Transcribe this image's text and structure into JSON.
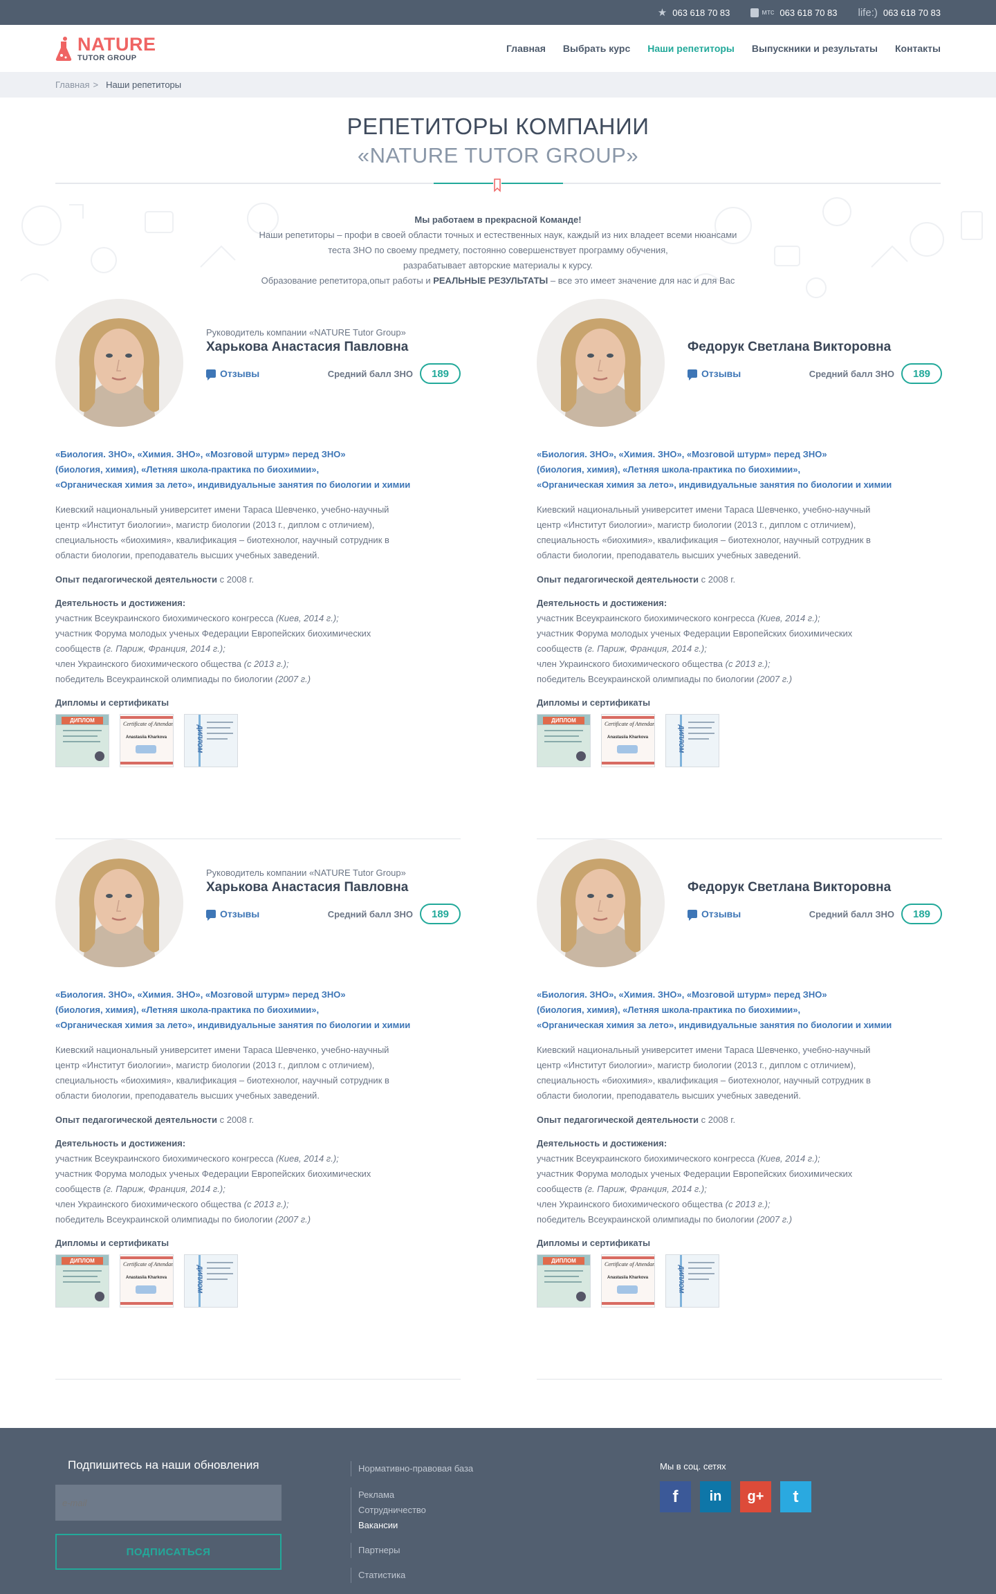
{
  "topbar": {
    "phones": [
      {
        "operator_icon": "star-icon",
        "operator_label": "",
        "number": "063 618 70 83"
      },
      {
        "operator_icon": "mts-icon",
        "operator_label": "мтс",
        "number": "063 618 70 83"
      },
      {
        "operator_icon": "life-icon",
        "operator_label": "life:)",
        "number": "063 618 70 83"
      }
    ]
  },
  "header": {
    "logo_main": "NATURE",
    "logo_sub": "TUTOR GROUP",
    "nav": [
      {
        "label": "Главная",
        "active": false
      },
      {
        "label": "Выбрать курс",
        "active": false
      },
      {
        "label": "Наши репетиторы",
        "active": true
      },
      {
        "label": "Выпускники и результаты",
        "active": false
      },
      {
        "label": "Контакты",
        "active": false
      }
    ]
  },
  "breadcrumb": {
    "home": "Главная",
    "separator": ">",
    "current": "Наши репетиторы"
  },
  "page": {
    "title_line1": "РЕПЕТИТОРЫ КОМПАНИИ",
    "title_line2": "«NATURE TUTOR GROUP»",
    "intro_bold": "Мы работаем в прекрасной Команде!",
    "intro_line1": "Наши репетиторы – профи в своей области точных и естественных наук, каждый из них владеет всеми нюансами",
    "intro_line2": "теста ЗНО по своему предмету,  постоянно совершенствует программу обучения,",
    "intro_line3": "разрабатывает авторские материалы к курсу.",
    "intro_line4_pre": "Образование репетитора,опыт работы и ",
    "intro_line4_bold": "РЕАЛЬНЫЕ РЕЗУЛЬТАТЫ",
    "intro_line4_post": " – все это имеет значение для нас и для Вас"
  },
  "tutors": [
    {
      "role": "Руководитель компании «NATURE Tutor Group»",
      "name": "Харькова Анастасия Павловна",
      "reviews_label": "Отзывы",
      "score_label": "Средний балл ЗНО",
      "score": "189",
      "courses_l1": "«Биология. ЗНО», «Химия. ЗНО», «Мозговой штурм» перед ЗНО»",
      "courses_l2": "(биология, химия), «Летняя школа-практика по биохимии»,",
      "courses_l3": "«Органическая химия за лето», индивидуальные занятия по биологии и химии",
      "edu_l1": "Киевский национальный университет имени Тараса Шевченко, учебно-научный",
      "edu_l2": "центр «Институт биологии», магистр биологии (2013 г., диплом с отличием),",
      "edu_l3": "специальность «биохимия», квалификация – биотехнолог, научный сотрудник в",
      "edu_l4": "области биологии, преподаватель высших учебных заведений.",
      "exp_label": "Опыт педагогической деятельности",
      "exp_value": " с 2008 г.",
      "ach_title": "Деятельность и достижения:",
      "ach_1": "участник Всеукраинского биохимического конгресса ",
      "ach_1i": "(Киев, 2014 г.);",
      "ach_2": "участник Форума молодых ученых Федерации Европейских биохимических",
      "ach_3": "сообществ ",
      "ach_3i": "(г. Париж, Франция, 2014 г.);",
      "ach_4": "член Украинского биохимического общества ",
      "ach_4i": "(с 2013 г.);",
      "ach_5": "победитель Всеукраинской олимпиады по биологии ",
      "ach_5i": "(2007 г.)",
      "diplomas_label": "Дипломы и сертификаты",
      "cert_1": "ДИПЛОМ",
      "cert_2": "Certificate of Attendan",
      "cert_2b": "Anastasiia Kharkova",
      "cert_3": "ДИПЛОМ"
    },
    {
      "role": "",
      "name": "Федорук Светлана Викторовна",
      "reviews_label": "Отзывы",
      "score_label": "Средний балл ЗНО",
      "score": "189",
      "courses_l1": "«Биология. ЗНО», «Химия. ЗНО», «Мозговой штурм» перед ЗНО»",
      "courses_l2": "(биология, химия), «Летняя школа-практика по биохимии»,",
      "courses_l3": "«Органическая химия за лето», индивидуальные занятия по биологии и химии",
      "edu_l1": "Киевский национальный университет имени Тараса Шевченко, учебно-научный",
      "edu_l2": "центр «Институт биологии», магистр биологии (2013 г., диплом с отличием),",
      "edu_l3": "специальность «биохимия», квалификация – биотехнолог, научный сотрудник в",
      "edu_l4": "области биологии, преподаватель высших учебных заведений.",
      "exp_label": "Опыт педагогической деятельности",
      "exp_value": " с 2008 г.",
      "ach_title": "Деятельность и достижения:",
      "ach_1": "участник Всеукраинского биохимического конгресса ",
      "ach_1i": "(Киев, 2014 г.);",
      "ach_2": "участник Форума молодых ученых Федерации Европейских биохимических",
      "ach_3": "сообществ ",
      "ach_3i": "(г. Париж, Франция, 2014 г.);",
      "ach_4": "член Украинского биохимического общества ",
      "ach_4i": "(с 2013 г.);",
      "ach_5": "победитель Всеукраинской олимпиады по биологии ",
      "ach_5i": "(2007 г.)",
      "diplomas_label": "Дипломы и сертификаты",
      "cert_1": "ДИПЛОМ",
      "cert_2": "Certificate of Attendan",
      "cert_2b": "Anastasiia Kharkova",
      "cert_3": "ДИПЛОМ"
    },
    {
      "role": "Руководитель компании «NATURE Tutor Group»",
      "name": "Харькова Анастасия Павловна",
      "reviews_label": "Отзывы",
      "score_label": "Средний балл ЗНО",
      "score": "189",
      "courses_l1": "«Биология. ЗНО», «Химия. ЗНО», «Мозговой штурм» перед ЗНО»",
      "courses_l2": "(биология, химия), «Летняя школа-практика по биохимии»,",
      "courses_l3": "«Органическая химия за лето», индивидуальные занятия по биологии и химии",
      "edu_l1": "Киевский национальный университет имени Тараса Шевченко, учебно-научный",
      "edu_l2": "центр «Институт биологии», магистр биологии (2013 г., диплом с отличием),",
      "edu_l3": "специальность «биохимия», квалификация – биотехнолог, научный сотрудник в",
      "edu_l4": "области биологии, преподаватель высших учебных заведений.",
      "exp_label": "Опыт педагогической деятельности",
      "exp_value": " с 2008 г.",
      "ach_title": "Деятельность и достижения:",
      "ach_1": "участник Всеукраинского биохимического конгресса ",
      "ach_1i": "(Киев, 2014 г.);",
      "ach_2": "участник Форума молодых ученых Федерации Европейских биохимических",
      "ach_3": "сообществ ",
      "ach_3i": "(г. Париж, Франция, 2014 г.);",
      "ach_4": "член Украинского биохимического общества ",
      "ach_4i": "(с 2013 г.);",
      "ach_5": "победитель Всеукраинской олимпиады по биологии ",
      "ach_5i": "(2007 г.)",
      "diplomas_label": "Дипломы и сертификаты",
      "cert_1": "ДИПЛОМ",
      "cert_2": "Certificate of Attendan",
      "cert_2b": "Anastasiia Kharkova",
      "cert_3": "ДИПЛОМ"
    },
    {
      "role": "",
      "name": "Федорук Светлана Викторовна",
      "reviews_label": "Отзывы",
      "score_label": "Средний балл ЗНО",
      "score": "189",
      "courses_l1": "«Биология. ЗНО», «Химия. ЗНО», «Мозговой штурм» перед ЗНО»",
      "courses_l2": "(биология, химия), «Летняя школа-практика по биохимии»,",
      "courses_l3": "«Органическая химия за лето», индивидуальные занятия по биологии и химии",
      "edu_l1": "Киевский национальный университет имени Тараса Шевченко, учебно-научный",
      "edu_l2": "центр «Институт биологии», магистр биологии (2013 г., диплом с отличием),",
      "edu_l3": "специальность «биохимия», квалификация – биотехнолог, научный сотрудник в",
      "edu_l4": "области биологии, преподаватель высших учебных заведений.",
      "exp_label": "Опыт педагогической деятельности",
      "exp_value": " с 2008 г.",
      "ach_title": "Деятельность и достижения:",
      "ach_1": "участник Всеукраинского биохимического конгресса ",
      "ach_1i": "(Киев, 2014 г.);",
      "ach_2": "участник Форума молодых ученых Федерации Европейских биохимических",
      "ach_3": "сообществ ",
      "ach_3i": "(г. Париж, Франция, 2014 г.);",
      "ach_4": "член Украинского биохимического общества ",
      "ach_4i": "(с 2013 г.);",
      "ach_5": "победитель Всеукраинской олимпиады по биологии ",
      "ach_5i": "(2007 г.)",
      "diplomas_label": "Дипломы и сертификаты",
      "cert_1": "ДИПЛОМ",
      "cert_2": "Certificate of Attendan",
      "cert_2b": "Anastasiia Kharkova",
      "cert_3": "ДИПЛОМ"
    }
  ],
  "footer": {
    "subscribe_title": "Подпишитесь на наши обновления",
    "email_placeholder": "e-mail",
    "subscribe_button": "ПОДПИСАТЬСЯ",
    "links_group1": [
      "Нормативно-правовая база"
    ],
    "links_group2": [
      "Реклама",
      "Сотрудничество",
      "Вакансии"
    ],
    "links_group3": [
      "Партнеры"
    ],
    "links_group4": [
      "Статистика"
    ],
    "social_title": "Мы в соц. сетях",
    "social": [
      {
        "name": "facebook-icon",
        "glyph": "f",
        "color": "#3b5998"
      },
      {
        "name": "linkedin-icon",
        "glyph": "in",
        "color": "#0e76a8"
      },
      {
        "name": "google-plus-icon",
        "glyph": "g+",
        "color": "#dd4b39"
      },
      {
        "name": "twitter-icon",
        "glyph": "t",
        "color": "#2aa9e0"
      }
    ]
  },
  "colors": {
    "accent": "#22a99a",
    "brand_red": "#ef6463",
    "link_blue": "#3e76b6",
    "topbar": "#505e6f",
    "footer": "#525f70"
  }
}
